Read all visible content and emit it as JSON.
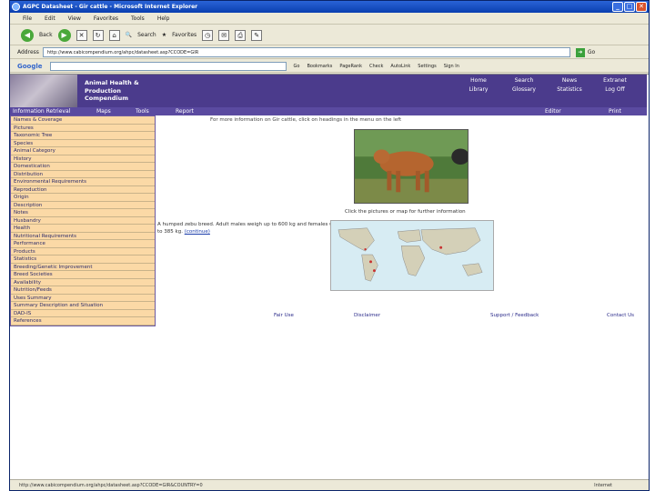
{
  "window": {
    "title": "AGPC Datasheet - Gir cattle - Microsoft Internet Explorer",
    "controls": [
      "_",
      "□",
      "✕"
    ]
  },
  "menubar": [
    "File",
    "Edit",
    "View",
    "Favorites",
    "Tools",
    "Help"
  ],
  "toolbar": {
    "back": "Back",
    "search": "Search",
    "favorites": "Favorites"
  },
  "addressbar": {
    "label": "Address",
    "url": "http://www.cabicompendium.org/ahpc/datasheet.asp?CCODE=GIR",
    "go": "Go"
  },
  "googlebar": {
    "logo": "Google",
    "items": [
      "Go",
      "Bookmarks",
      "PageRank",
      "Check",
      "AutoLink",
      "Settings",
      "Sign In"
    ]
  },
  "site": {
    "title_lines": [
      "Animal Health &",
      "Production",
      "Compendium"
    ],
    "top_links": [
      "Home",
      "Search",
      "News",
      "Extranet",
      "Library",
      "Glossary",
      "Statistics",
      "Log Off"
    ],
    "nav": [
      "Information Retrieval",
      "Maps",
      "Tools",
      "Report",
      "Editor",
      "Print"
    ]
  },
  "left_menu": [
    "Names & Coverage",
    "Pictures",
    "Taxonomic Tree",
    "Species",
    "Animal Category",
    "History",
    "Domestication",
    "Distribution",
    "Environmental Requirements",
    "Reproduction",
    "Origin",
    "Description",
    "Notes",
    "Husbandry",
    "Health",
    "Nutritional Requirements",
    "Performance",
    "Products",
    "Statistics",
    "Breeding/Genetic Improvement",
    "Breed Societies",
    "Availability",
    "Nutrition/Feeds",
    "Uses Summary",
    "Summary Description and Situation",
    "DAD-IS",
    "References"
  ],
  "content": {
    "intro": "For more information on Gir cattle, click on headings in the menu on the left",
    "photo_caption": "Click the pictures or map for further information",
    "description": "A humped zebu breed. Adult males weigh up to 600 kg and females up to 385 kg.",
    "continue_link": "(continue)"
  },
  "footer": {
    "fair_use": "Fair Use",
    "disclaimer": "Disclaimer",
    "support": "Support / Feedback",
    "contact": "Contact Us"
  },
  "status": {
    "url": "http://www.cabicompendium.org/ahpc/datasheet.asp?CCODE=GIR&COUNTRY=0",
    "zone": "Internet"
  }
}
